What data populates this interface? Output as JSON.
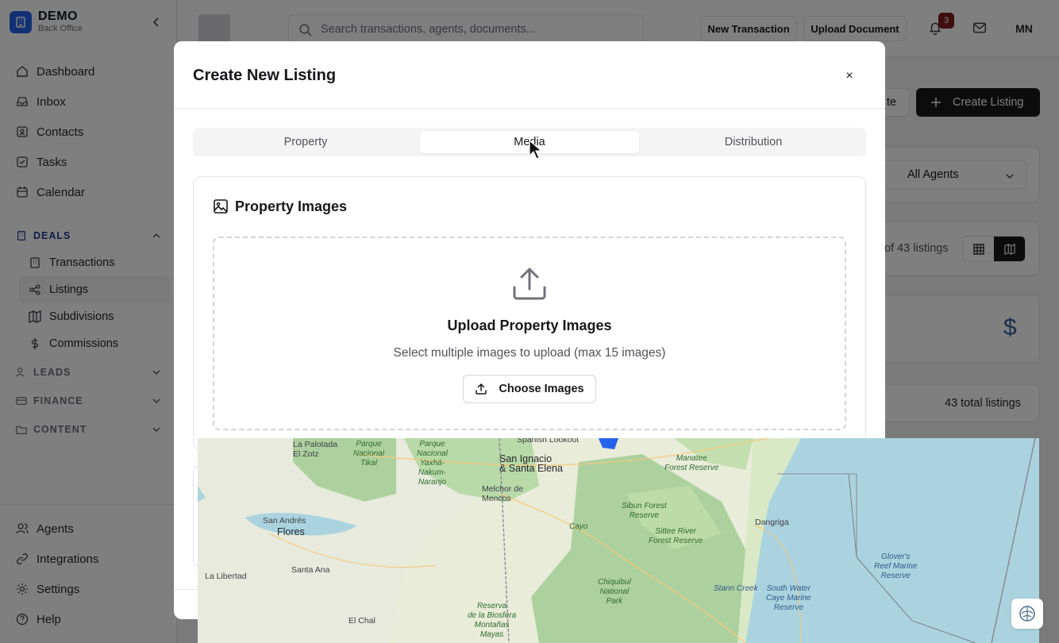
{
  "brand": {
    "name": "DEMO",
    "sub": "Back Office"
  },
  "nav_top": [
    {
      "label": "Dashboard",
      "icon": "home-icon"
    },
    {
      "label": "Inbox",
      "icon": "inbox-icon"
    },
    {
      "label": "Contacts",
      "icon": "contacts-icon"
    },
    {
      "label": "Tasks",
      "icon": "tasks-icon"
    },
    {
      "label": "Calendar",
      "icon": "calendar-icon"
    }
  ],
  "sections": {
    "deals": "DEALS",
    "leads": "LEADS",
    "finance": "FINANCE",
    "content": "CONTENT"
  },
  "deals_items": [
    {
      "label": "Transactions"
    },
    {
      "label": "Listings",
      "active": true
    },
    {
      "label": "Subdivisions"
    },
    {
      "label": "Commissions"
    }
  ],
  "nav_bottom": [
    {
      "label": "Agents"
    },
    {
      "label": "Integrations"
    },
    {
      "label": "Settings"
    },
    {
      "label": "Help"
    }
  ],
  "header": {
    "search_placeholder": "Search transactions, agents, documents...",
    "new_transaction": "New Transaction",
    "upload_document": "Upload Document",
    "notification_count": "3",
    "avatar_initials": "MN"
  },
  "background": {
    "te_label": "te",
    "create_listing": "Create Listing",
    "agents_filter": "All Agents",
    "listings_count": "of 43 listings",
    "total_listings": "43 total listings",
    "dollar_symbol": "$"
  },
  "modal": {
    "title": "Create New Listing",
    "close": "×",
    "tabs": [
      "Property",
      "Media",
      "Distribution"
    ],
    "active_tab": "Media",
    "section_title": "Property Images",
    "upload_title": "Upload Property Images",
    "upload_sub": "Select multiple images to upload (max 15 images)",
    "choose_button": "Choose Images"
  },
  "map": {
    "labels": {
      "la_palotada": "La Palotada\nEl Zotz",
      "parque_tikal": "Parque\nNacional\nTikal",
      "yaxha": "Parque\nNacional\nYaxhá-\nNakum-\nNaranjo",
      "spanish_lookout": "Spanish Lookout",
      "san_ignacio": "San Ignacio\n& Santa Elena",
      "melchor": "Melchor de\nMencos",
      "manatee": "Manatee\nForest Reserve",
      "san_andres": "San Andrés",
      "flores": "Flores",
      "sibun": "Sibun Forest\nReserve",
      "cayo": "Cayo",
      "sittee": "Sittee River\nForest Reserve",
      "dangriga": "Dangriga",
      "glovers": "Glover's\nReef Marine\nReserve",
      "la_libertad": "La Libertad",
      "santa_ana": "Santa Ana",
      "chiquibul": "Chiquibul\nNational\nPark",
      "stann_creek": "Stann Creek",
      "south_water": "South Water\nCaye Marine\nReserve",
      "el_chal": "El Chal",
      "biosfera": "Reserva\nde la Biosfera\nMontañas\nMayas"
    }
  },
  "colors": {
    "brand": "#2563eb",
    "dark_button": "#18181b",
    "sea": "#aad3df",
    "forest": "#add19e"
  }
}
